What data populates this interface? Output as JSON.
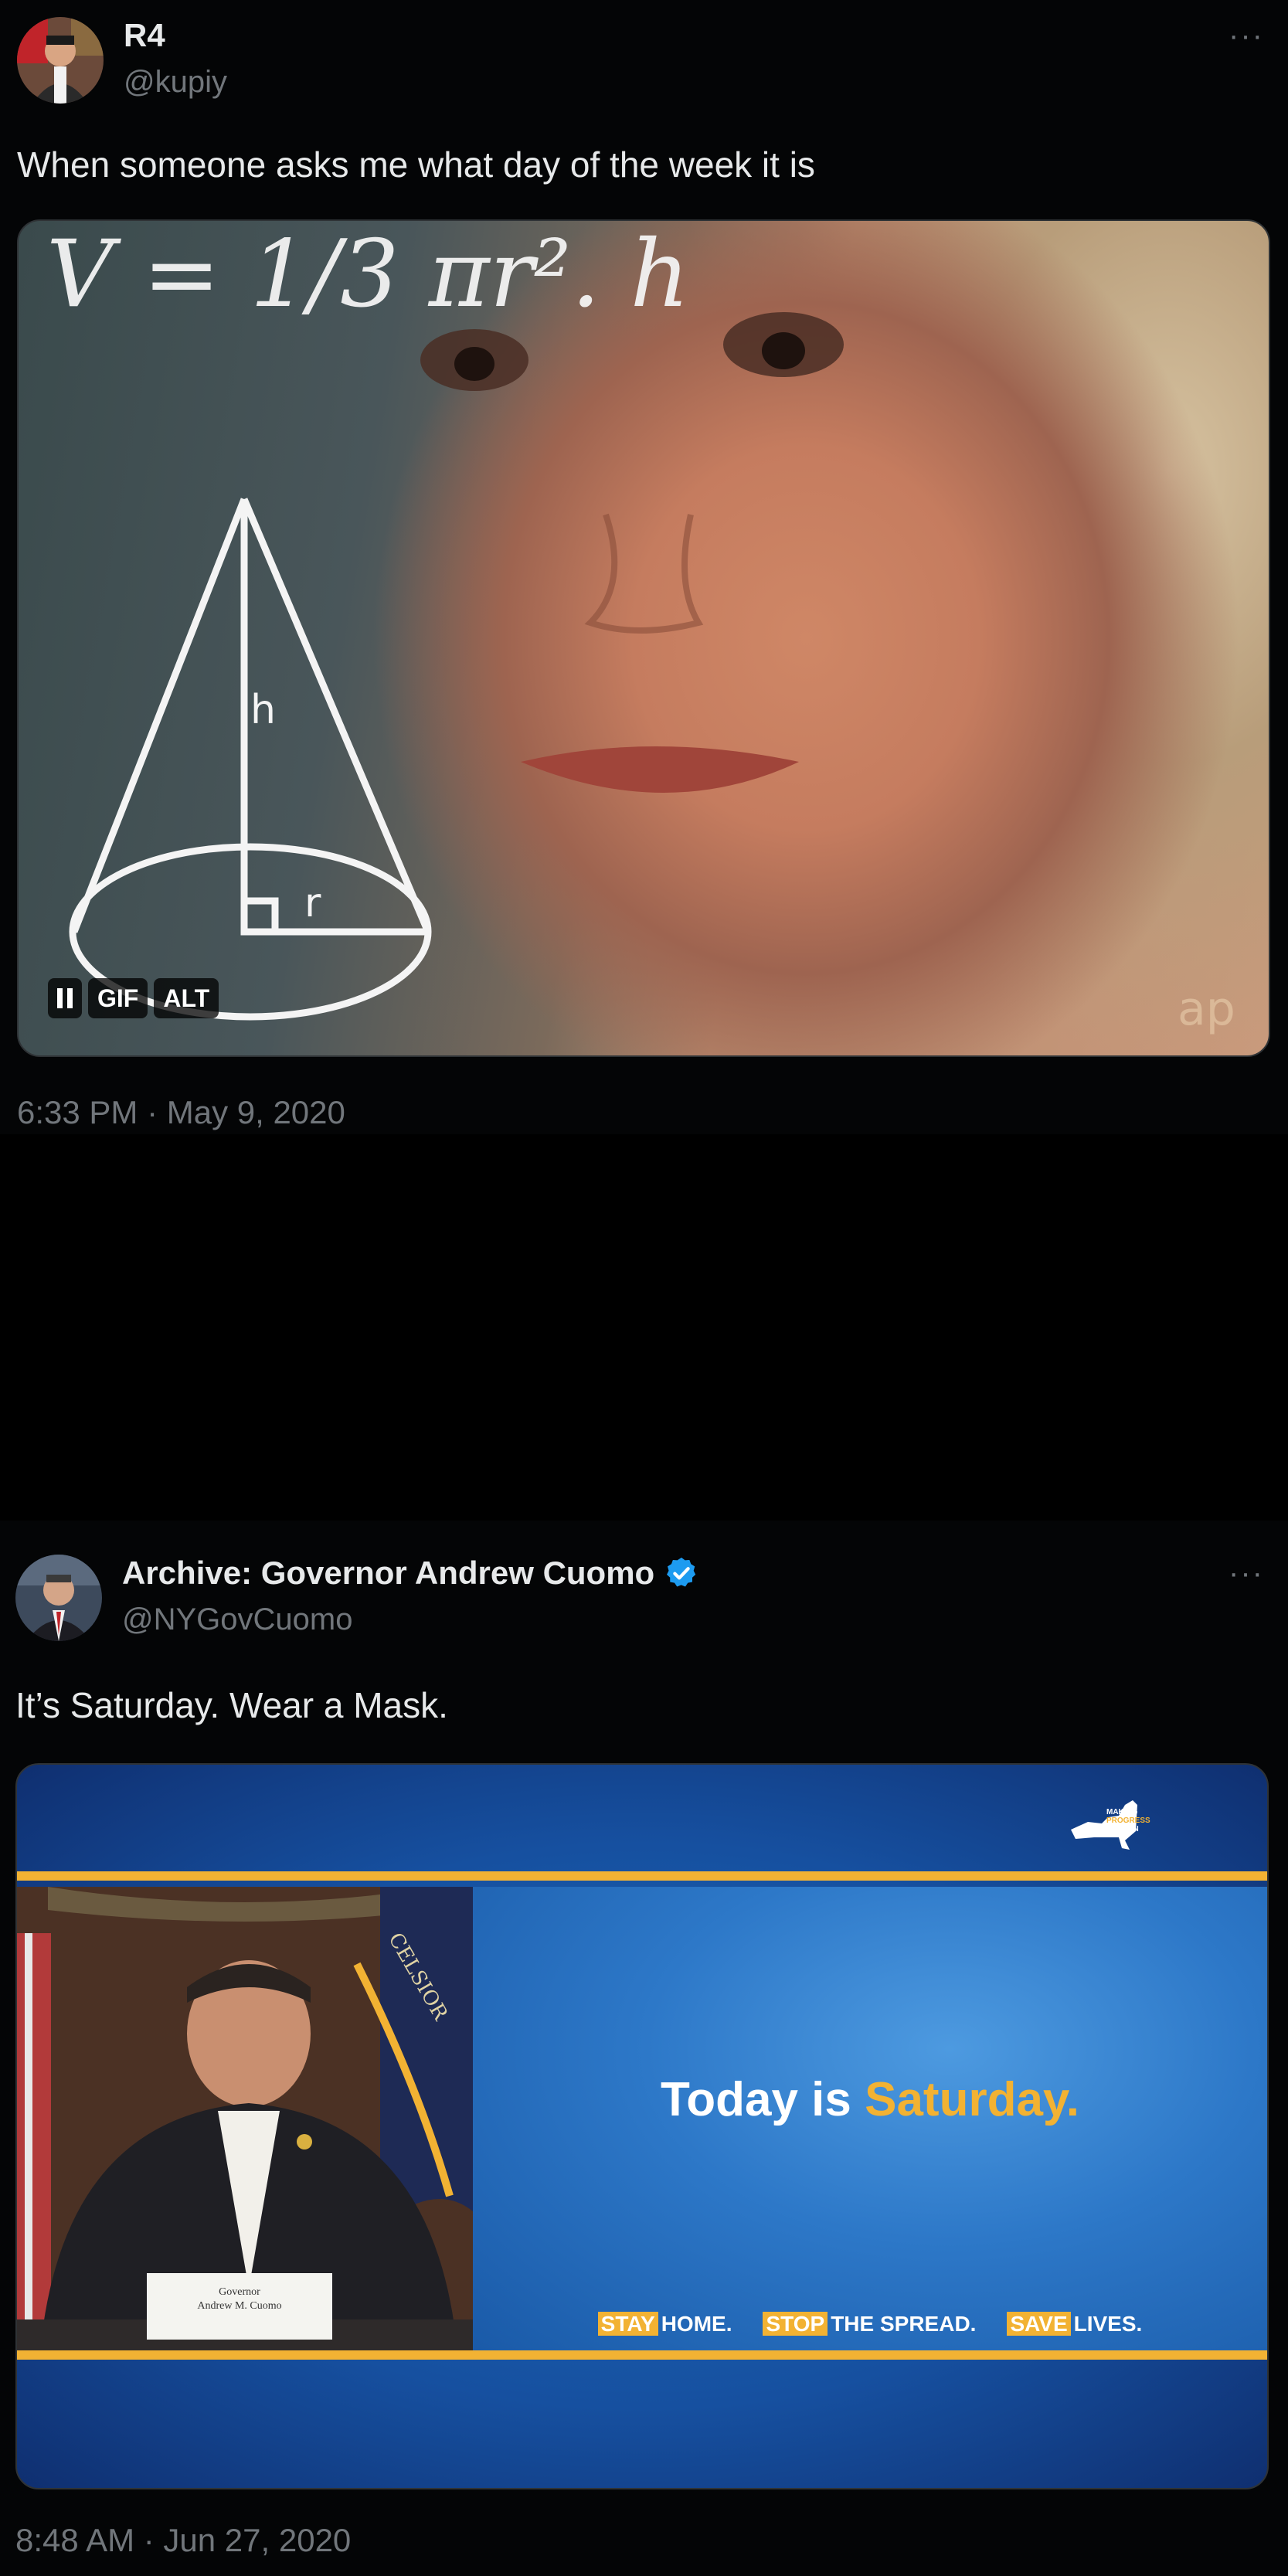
{
  "tweet1": {
    "name": "R4",
    "handle": "@kupiy",
    "more_label": "···",
    "text": "When someone asks me what day of the week it is",
    "media": {
      "formula_text": "V = 1/3 πr². h",
      "diagram_h": "h",
      "diagram_r": "r",
      "watermark": "ap",
      "gif_label": "GIF",
      "alt_label": "ALT"
    },
    "timestamp": "6:33 PM · May 9, 2020"
  },
  "tweet2": {
    "name": "Archive: Governor Andrew Cuomo",
    "verified": true,
    "handle": "@NYGovCuomo",
    "more_label": "···",
    "text": "It’s Saturday. Wear a Mask.",
    "media": {
      "slide_title_prefix": "Today is ",
      "slide_title_highlight": "Saturday.",
      "footer": [
        {
          "tag": "STAY",
          "rest": "HOME."
        },
        {
          "tag": "STOP",
          "rest": "THE SPREAD."
        },
        {
          "tag": "SAVE",
          "rest": "LIVES."
        }
      ],
      "nameplate_line1": "Governor",
      "nameplate_line2": "Andrew M. Cuomo",
      "seal_text": "CELSIOR",
      "logo_text": [
        "MAKING",
        "PROGRESS",
        "HAPPEN"
      ]
    },
    "timestamp": "8:48 AM · Jun 27, 2020"
  },
  "colors": {
    "background": "#000000",
    "tweet_bg": "#040506",
    "muted": "#71767b",
    "verified": "#1d9bf0",
    "gold": "#f2b233"
  }
}
